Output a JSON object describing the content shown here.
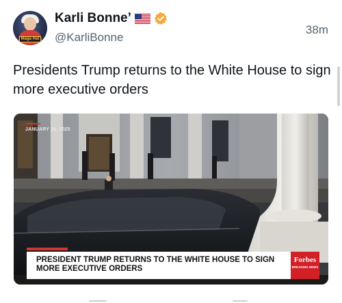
{
  "user": {
    "display_name": "Karli Bonne’",
    "handle": "@KarliBonne",
    "flag_icon": "us-flag-icon",
    "verified_icon": "verified-badge-icon",
    "verified_color": "#f4a93b",
    "avatar_label": "Maga Hat"
  },
  "post": {
    "timestamp": "38m",
    "text": "Presidents Trump returns to the White House to sign more executive orders"
  },
  "media": {
    "date_overlay": "JANUARY 20, 2025",
    "chyron": "PRESIDENT TRUMP RETURNS TO THE WHITE HOUSE TO SIGN MORE EXECUTIVE ORDERS",
    "brand": "Forbes",
    "brand_sub": "BREAKING NEWS",
    "brand_color": "#d32027",
    "accent_color": "#d9342b"
  }
}
